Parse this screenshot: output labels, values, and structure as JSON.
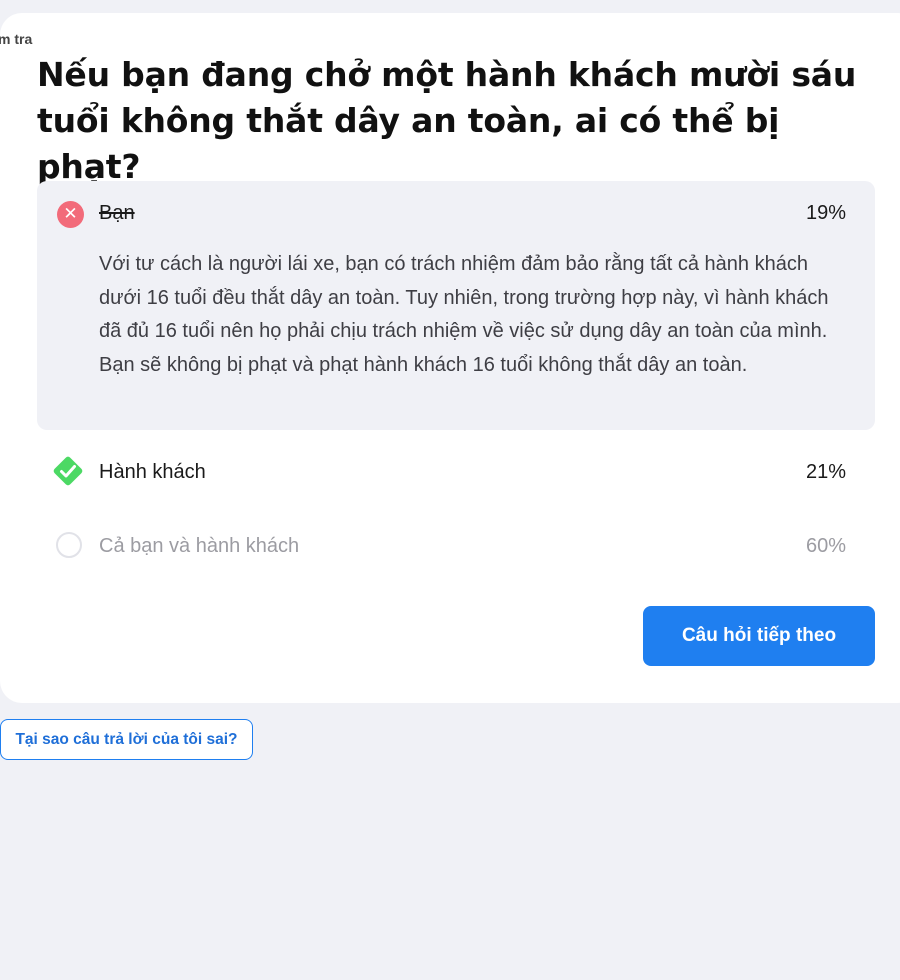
{
  "breadcrumb": "m tra",
  "question": "Nếu bạn đang chở một hành khách mười sáu tuổi không thắt dây an toàn, ai có thể bị phạt?",
  "options": [
    {
      "label": "Bạn",
      "percent": "19%",
      "state": "wrong-selected",
      "explanation": "Với tư cách là người lái xe, bạn có trách nhiệm đảm bảo rằng tất cả hành khách dưới 16 tuổi đều thắt dây an toàn. Tuy nhiên, trong trường hợp này, vì hành khách đã đủ 16 tuổi nên họ phải chịu trách nhiệm về việc sử dụng dây an toàn của mình. Bạn sẽ không bị phạt và phạt hành khách 16 tuổi không thắt dây an toàn."
    },
    {
      "label": "Hành khách",
      "percent": "21%",
      "state": "correct"
    },
    {
      "label": "Cả bạn và hành khách",
      "percent": "60%",
      "state": "unselected"
    }
  ],
  "next_button": "Câu hỏi tiếp theo",
  "why_button": "Tại sao câu trả lời của tôi sai?",
  "icons": {
    "wrong": "x-circle-icon",
    "correct": "check-diamond-icon",
    "unselected": "empty-circle-icon"
  },
  "colors": {
    "accent": "#1f7ff0",
    "wrong": "#f26b7a",
    "correct": "#4cd964",
    "background": "#f0f1f6"
  }
}
